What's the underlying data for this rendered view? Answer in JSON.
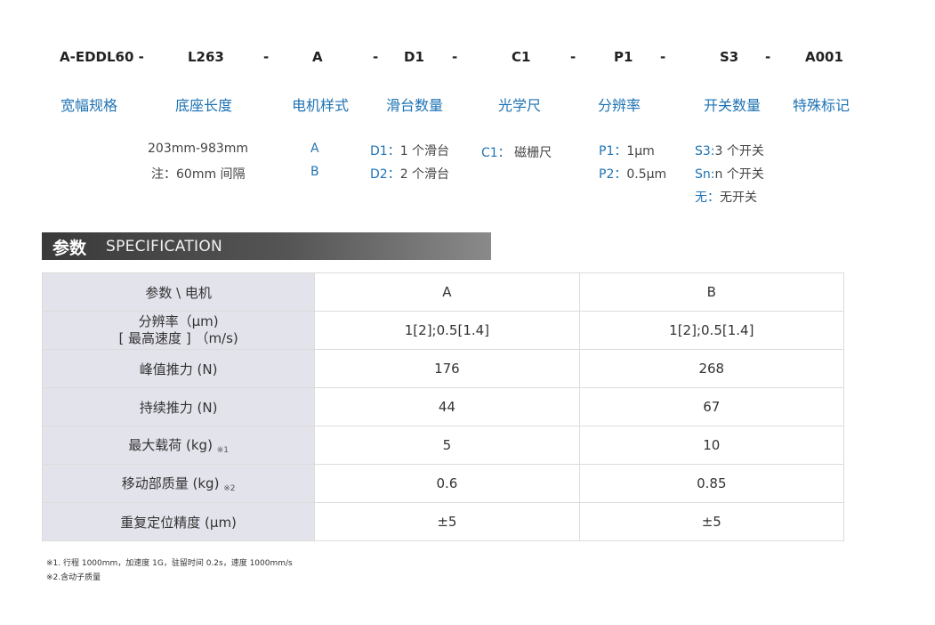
{
  "model_code": [
    "A-EDDL60 -",
    "L263",
    "-",
    "A",
    "-",
    "D1",
    "-",
    "C1",
    "-",
    "P1",
    "-",
    "S3",
    "-",
    "A001"
  ],
  "labels": [
    "宽幅规格",
    "底座长度",
    "电机样式",
    "滑台数量",
    "光学尺",
    "分辨率",
    "开关数量",
    "特殊标记"
  ],
  "options": {
    "length": [
      "203mm-983mm",
      "注：60mm 间隔"
    ],
    "motor": [
      "A",
      "B"
    ],
    "slider": [
      {
        "code": "D1：",
        "text": "1 个滑台"
      },
      {
        "code": "D2：",
        "text": "2 个滑台"
      }
    ],
    "scale": [
      {
        "code": "C1：",
        "text": "磁栅尺"
      }
    ],
    "resolution": [
      {
        "code": "P1：",
        "text": "1μm"
      },
      {
        "code": "P2：",
        "text": "0.5μm"
      }
    ],
    "switch": [
      {
        "code": "S3:",
        "text": "3 个开关"
      },
      {
        "code": "Sn:",
        "text": "n 个开关"
      },
      {
        "code": "无：",
        "text": "无开关"
      }
    ]
  },
  "spec_title": {
    "cn": "参数",
    "en": "SPECIFICATION"
  },
  "table": {
    "header": [
      "参数 \\ 电机",
      "A",
      "B"
    ],
    "rows": [
      {
        "param": "分辨率（μm)",
        "param2": "[ 最高速度 ] （m/s)",
        "note": "",
        "a": "1[2];0.5[1.4]",
        "b": "1[2];0.5[1.4]"
      },
      {
        "param": "峰值推力 (N)",
        "param2": "",
        "note": "",
        "a": "176",
        "b": "268"
      },
      {
        "param": "持续推力 (N)",
        "param2": "",
        "note": "",
        "a": "44",
        "b": "67"
      },
      {
        "param": "最大载荷 (kg)",
        "param2": "",
        "note": "※1",
        "a": "5",
        "b": "10"
      },
      {
        "param": "移动部质量 (kg)",
        "param2": "",
        "note": "※2",
        "a": "0.6",
        "b": "0.85"
      },
      {
        "param": "重复定位精度 (μm)",
        "param2": "",
        "note": "",
        "a": "±5",
        "b": "±5"
      }
    ]
  },
  "footnotes": [
    "※1. 行程 1000mm，加速度 1G，驻留时间 0.2s，速度 1000mm/s",
    "※2.含动子质量"
  ]
}
